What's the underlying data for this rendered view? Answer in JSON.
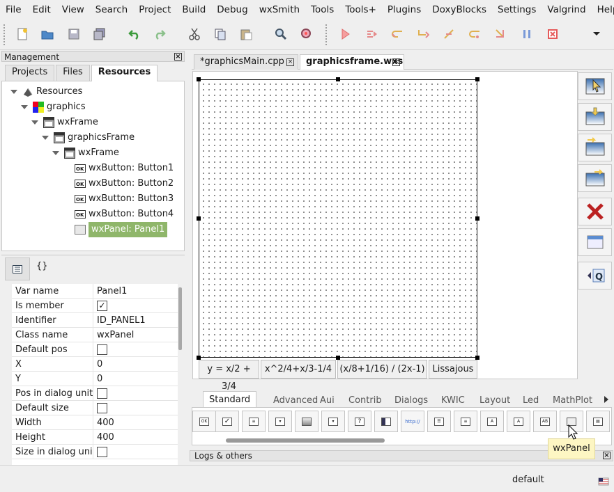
{
  "menubar": [
    "File",
    "Edit",
    "View",
    "Search",
    "Project",
    "Build",
    "Debug",
    "wxSmith",
    "Tools",
    "Tools+",
    "Plugins",
    "DoxyBlocks",
    "Settings",
    "Valgrind",
    "Help"
  ],
  "management": {
    "title": "Management",
    "tabs": [
      "Projects",
      "Files",
      "Resources"
    ],
    "active_tab": "Resources",
    "tree": [
      {
        "label": "Resources",
        "depth": 0,
        "icon": "resources-icon",
        "expanded": true
      },
      {
        "label": "graphics",
        "depth": 1,
        "icon": "project-icon",
        "expanded": true
      },
      {
        "label": "wxFrame",
        "depth": 2,
        "icon": "frame-icon",
        "expanded": true
      },
      {
        "label": "graphicsFrame",
        "depth": 3,
        "icon": "frame-icon",
        "expanded": true
      },
      {
        "label": "wxFrame",
        "depth": 4,
        "icon": "frame-icon",
        "expanded": true
      },
      {
        "label": "wxButton: Button1",
        "depth": 5,
        "icon": "button-icon"
      },
      {
        "label": "wxButton: Button2",
        "depth": 5,
        "icon": "button-icon"
      },
      {
        "label": "wxButton: Button3",
        "depth": 5,
        "icon": "button-icon"
      },
      {
        "label": "wxButton: Button4",
        "depth": 5,
        "icon": "button-icon"
      },
      {
        "label": "wxPanel: Panel1",
        "depth": 5,
        "icon": "panel-icon",
        "selected": true
      }
    ],
    "properties": [
      {
        "name": "Var name",
        "value": "Panel1"
      },
      {
        "name": "Is member",
        "check": true
      },
      {
        "name": "Identifier",
        "value": "ID_PANEL1"
      },
      {
        "name": "Class name",
        "value": "wxPanel"
      },
      {
        "name": "Default pos",
        "check": false
      },
      {
        "name": "X",
        "value": "0"
      },
      {
        "name": "Y",
        "value": "0"
      },
      {
        "name": "Pos in dialog units",
        "check": false
      },
      {
        "name": "Default size",
        "check": false
      },
      {
        "name": "Width",
        "value": "400"
      },
      {
        "name": "Height",
        "value": "400"
      },
      {
        "name": "Size in dialog units",
        "check": false
      }
    ]
  },
  "editor": {
    "tabs": [
      "*graphicsMain.cpp",
      "graphicsframe.wxs"
    ],
    "active_tab": "graphicsframe.wxs",
    "buttons": [
      "y = x/2 + 3/4",
      "x^2/4+x/3-1/4",
      "(x/8+1/16) / (2x-1)",
      "Lissajous"
    ]
  },
  "palette": {
    "tabs": [
      "Standard",
      "Advanced",
      "Aui",
      "Contrib",
      "Dialogs",
      "KWIC",
      "Layout",
      "Led",
      "MathPlot"
    ],
    "active_tab": "Standard",
    "tooltip": "wxPanel"
  },
  "logs": {
    "title": "Logs & others"
  },
  "status": {
    "text": "default"
  },
  "colors": {
    "selection": "#8fb66a",
    "tooltip": "#fdf6c3",
    "accent_red": "#e55a5a"
  }
}
